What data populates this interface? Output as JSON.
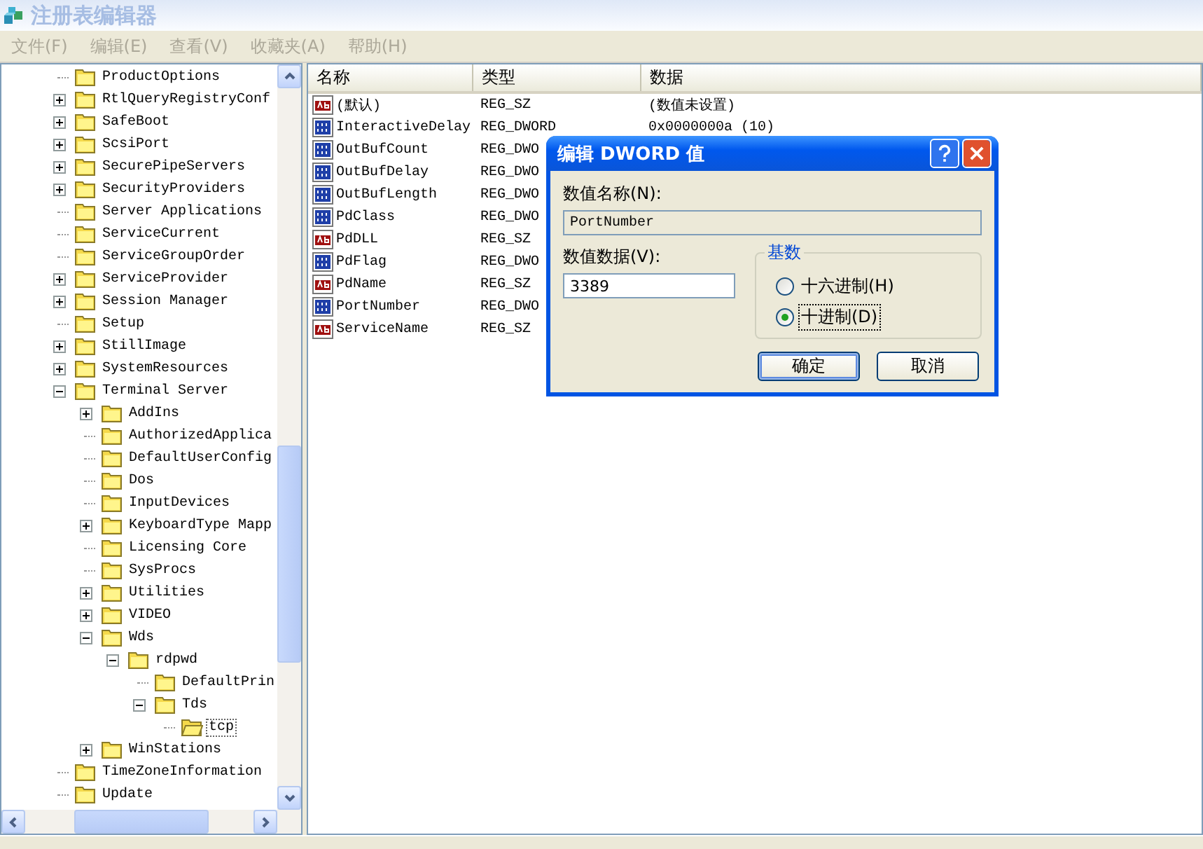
{
  "window": {
    "title": "注册表编辑器"
  },
  "menu": [
    {
      "label": "文件(F)",
      "disabled": true
    },
    {
      "label": "编辑(E)",
      "disabled": true
    },
    {
      "label": "查看(V)",
      "disabled": true
    },
    {
      "label": "收藏夹(A)",
      "disabled": true
    },
    {
      "label": "帮助(H)",
      "disabled": true
    }
  ],
  "tree": {
    "items": [
      {
        "label": "ProductOptions",
        "expandable": false,
        "selected": false
      },
      {
        "label": "RtlQueryRegistryConf",
        "expandable": true,
        "expanded": false,
        "selected": false
      },
      {
        "label": "SafeBoot",
        "expandable": true,
        "expanded": false,
        "selected": false
      },
      {
        "label": "ScsiPort",
        "expandable": true,
        "expanded": false,
        "selected": false
      },
      {
        "label": "SecurePipeServers",
        "expandable": true,
        "expanded": false,
        "selected": false
      },
      {
        "label": "SecurityProviders",
        "expandable": true,
        "expanded": false,
        "selected": false
      },
      {
        "label": "Server Applications",
        "expandable": false,
        "selected": false
      },
      {
        "label": "ServiceCurrent",
        "expandable": false,
        "selected": false
      },
      {
        "label": "ServiceGroupOrder",
        "expandable": false,
        "selected": false
      },
      {
        "label": "ServiceProvider",
        "expandable": true,
        "expanded": false,
        "selected": false
      },
      {
        "label": "Session Manager",
        "expandable": true,
        "expanded": false,
        "selected": false
      },
      {
        "label": "Setup",
        "expandable": false,
        "selected": false
      },
      {
        "label": "StillImage",
        "expandable": true,
        "expanded": false,
        "selected": false
      },
      {
        "label": "SystemResources",
        "expandable": true,
        "expanded": false,
        "selected": false
      },
      {
        "label": "Terminal Server",
        "expandable": true,
        "expanded": true,
        "selected": false,
        "children": [
          {
            "label": "AddIns",
            "expandable": true,
            "expanded": false,
            "selected": false
          },
          {
            "label": "AuthorizedApplica",
            "expandable": false,
            "selected": false
          },
          {
            "label": "DefaultUserConfig",
            "expandable": false,
            "selected": false
          },
          {
            "label": "Dos",
            "expandable": false,
            "selected": false
          },
          {
            "label": "InputDevices",
            "expandable": false,
            "selected": false
          },
          {
            "label": "KeyboardType Mapp",
            "expandable": true,
            "expanded": false,
            "selected": false
          },
          {
            "label": "Licensing Core",
            "expandable": false,
            "selected": false
          },
          {
            "label": "SysProcs",
            "expandable": false,
            "selected": false
          },
          {
            "label": "Utilities",
            "expandable": true,
            "expanded": false,
            "selected": false
          },
          {
            "label": "VIDEO",
            "expandable": true,
            "expanded": false,
            "selected": false
          },
          {
            "label": "Wds",
            "expandable": true,
            "expanded": true,
            "selected": false,
            "children": [
              {
                "label": "rdpwd",
                "expandable": true,
                "expanded": true,
                "selected": false,
                "children": [
                  {
                    "label": "DefaultPrin",
                    "expandable": false,
                    "selected": false
                  },
                  {
                    "label": "Tds",
                    "expandable": true,
                    "expanded": true,
                    "selected": false,
                    "children": [
                      {
                        "label": "tcp",
                        "expandable": false,
                        "selected": true
                      }
                    ]
                  }
                ]
              }
            ]
          },
          {
            "label": "WinStations",
            "expandable": true,
            "expanded": false,
            "selected": false
          }
        ]
      },
      {
        "label": "TimeZoneInformation",
        "expandable": false,
        "selected": false
      },
      {
        "label": "Update",
        "expandable": false,
        "selected": false
      }
    ]
  },
  "list": {
    "columns": [
      "名称",
      "类型",
      "数据"
    ],
    "rows": [
      {
        "name": "(默认)",
        "kind": "string",
        "type": "REG_SZ",
        "data": "(数值未设置)"
      },
      {
        "name": "InteractiveDelay",
        "kind": "dword",
        "type": "REG_DWORD",
        "data": "0x0000000a (10)"
      },
      {
        "name": "OutBufCount",
        "kind": "dword",
        "type": "REG_DWO"
      },
      {
        "name": "OutBufDelay",
        "kind": "dword",
        "type": "REG_DWO"
      },
      {
        "name": "OutBufLength",
        "kind": "dword",
        "type": "REG_DWO"
      },
      {
        "name": "PdClass",
        "kind": "dword",
        "type": "REG_DWO"
      },
      {
        "name": "PdDLL",
        "kind": "string",
        "type": "REG_SZ"
      },
      {
        "name": "PdFlag",
        "kind": "dword",
        "type": "REG_DWO"
      },
      {
        "name": "PdName",
        "kind": "string",
        "type": "REG_SZ"
      },
      {
        "name": "PortNumber",
        "kind": "dword",
        "type": "REG_DWO"
      },
      {
        "name": "ServiceName",
        "kind": "string",
        "type": "REG_SZ"
      }
    ]
  },
  "dialog": {
    "title": "编辑 DWORD 值",
    "name_label": "数值名称(N):",
    "name_value": "PortNumber",
    "data_label": "数值数据(V):",
    "data_value": "3389",
    "base": {
      "label": "基数",
      "options": [
        {
          "label": "十六进制(H)",
          "selected": false
        },
        {
          "label": "十进制(D)",
          "selected": true
        }
      ]
    },
    "buttons": [
      {
        "label": "确定",
        "default": true
      },
      {
        "label": "取消",
        "default": false
      }
    ]
  }
}
